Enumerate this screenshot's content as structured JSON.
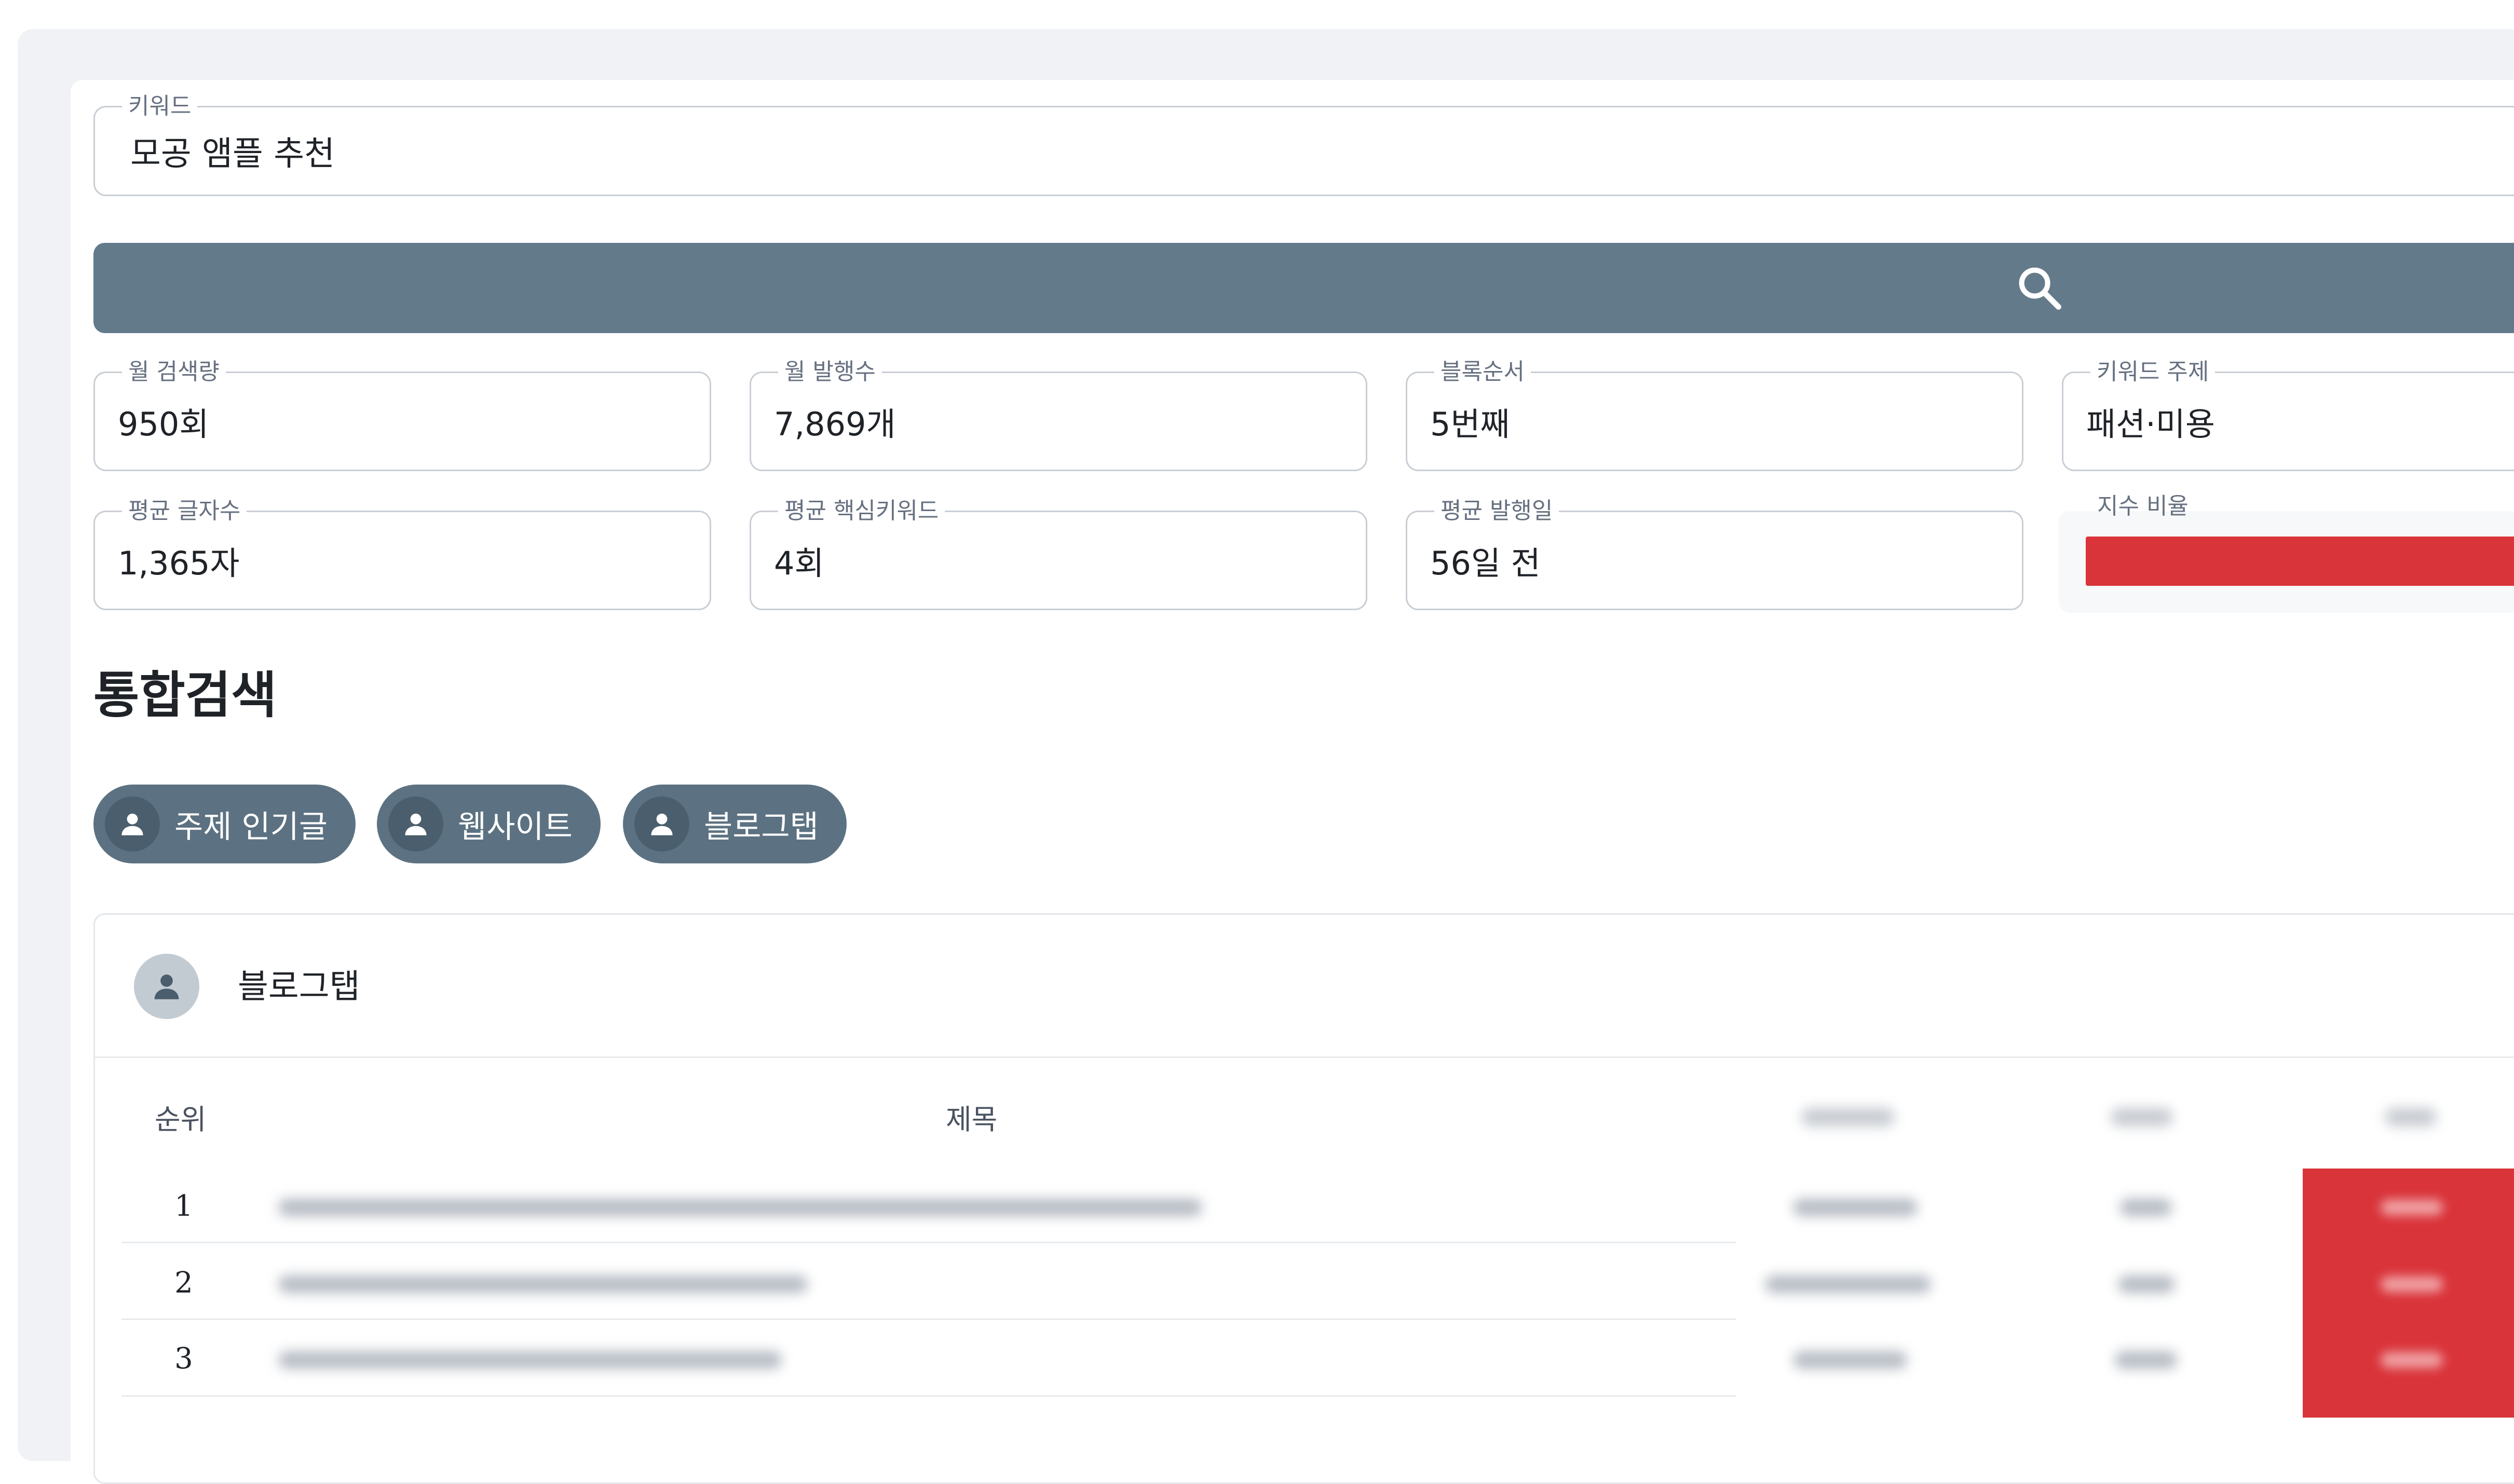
{
  "keyword": {
    "label": "키워드",
    "value": "모공 앰플 추천"
  },
  "search": {
    "icon": "search-icon",
    "button_color": "#637a8b"
  },
  "stats": [
    {
      "label": "월 검색량",
      "value": "950회"
    },
    {
      "label": "월 발행수",
      "value": "7,869개"
    },
    {
      "label": "블록순서",
      "value": "5번째"
    },
    {
      "label": "키워드 주제",
      "value": "패션·미용"
    },
    {
      "label": "평균 글자수",
      "value": "1,365자"
    },
    {
      "label": "평균 핵심키워드",
      "value": "4회"
    },
    {
      "label": "평균 발행일",
      "value": "56일 전"
    }
  ],
  "ratio": {
    "label": "지수 비율",
    "bar_color": "#d9343a"
  },
  "section": {
    "title": "통합검색"
  },
  "chips": [
    {
      "label": "주제 인기글",
      "icon": "person-icon"
    },
    {
      "label": "웹사이트",
      "icon": "person-icon"
    },
    {
      "label": "블로그탭",
      "icon": "person-icon"
    }
  ],
  "panel": {
    "title": "블로그탭",
    "icon": "person-icon",
    "columns": {
      "rank": "순위",
      "title": "제목"
    },
    "rows": [
      {
        "rank": "1"
      },
      {
        "rank": "2"
      },
      {
        "rank": "3"
      }
    ],
    "accent_color": "#d9343a"
  }
}
